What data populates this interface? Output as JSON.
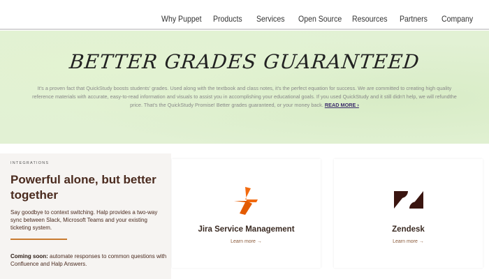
{
  "nav": {
    "items": [
      "Why Puppet",
      "Products",
      "Services",
      "Open Source",
      "Resources",
      "Partners",
      "Company"
    ]
  },
  "banner": {
    "title": "BETTER GRADES GUARANTEED",
    "body": "It's a proven fact that QuickStudy boosts students' grades. Used along with the textbook and class notes, it's the perfect equation for success. We are committed to creating high quality reference materials with accurate, easy-to-read information and visuals to assist you in accomplishing your educational goals. If you used QuickStudy and it still didn't help, we will refundthe price. That's the QuickStudy Promise! Better grades guaranteed, or your money back.",
    "read_more": "READ MORE ›"
  },
  "integrations": {
    "eyebrow": "INTEGRATIONS",
    "heading": "Powerful alone, but better together",
    "description": "Say goodbye to context switching. Halp provides a two-way sync between Slack, Microsoft Teams and your existing ticketing system.",
    "coming_soon_label": "Coming soon:",
    "coming_soon_text": " automate responses to common questions with Confluence and Halp Answers.",
    "accent": "#c87a2f"
  },
  "cards": [
    {
      "name": "Jira Service Management",
      "link": "Learn more →",
      "color": "#f06a10"
    },
    {
      "name": "Zendesk",
      "link": "Learn more →",
      "color": "#3a1510"
    }
  ]
}
